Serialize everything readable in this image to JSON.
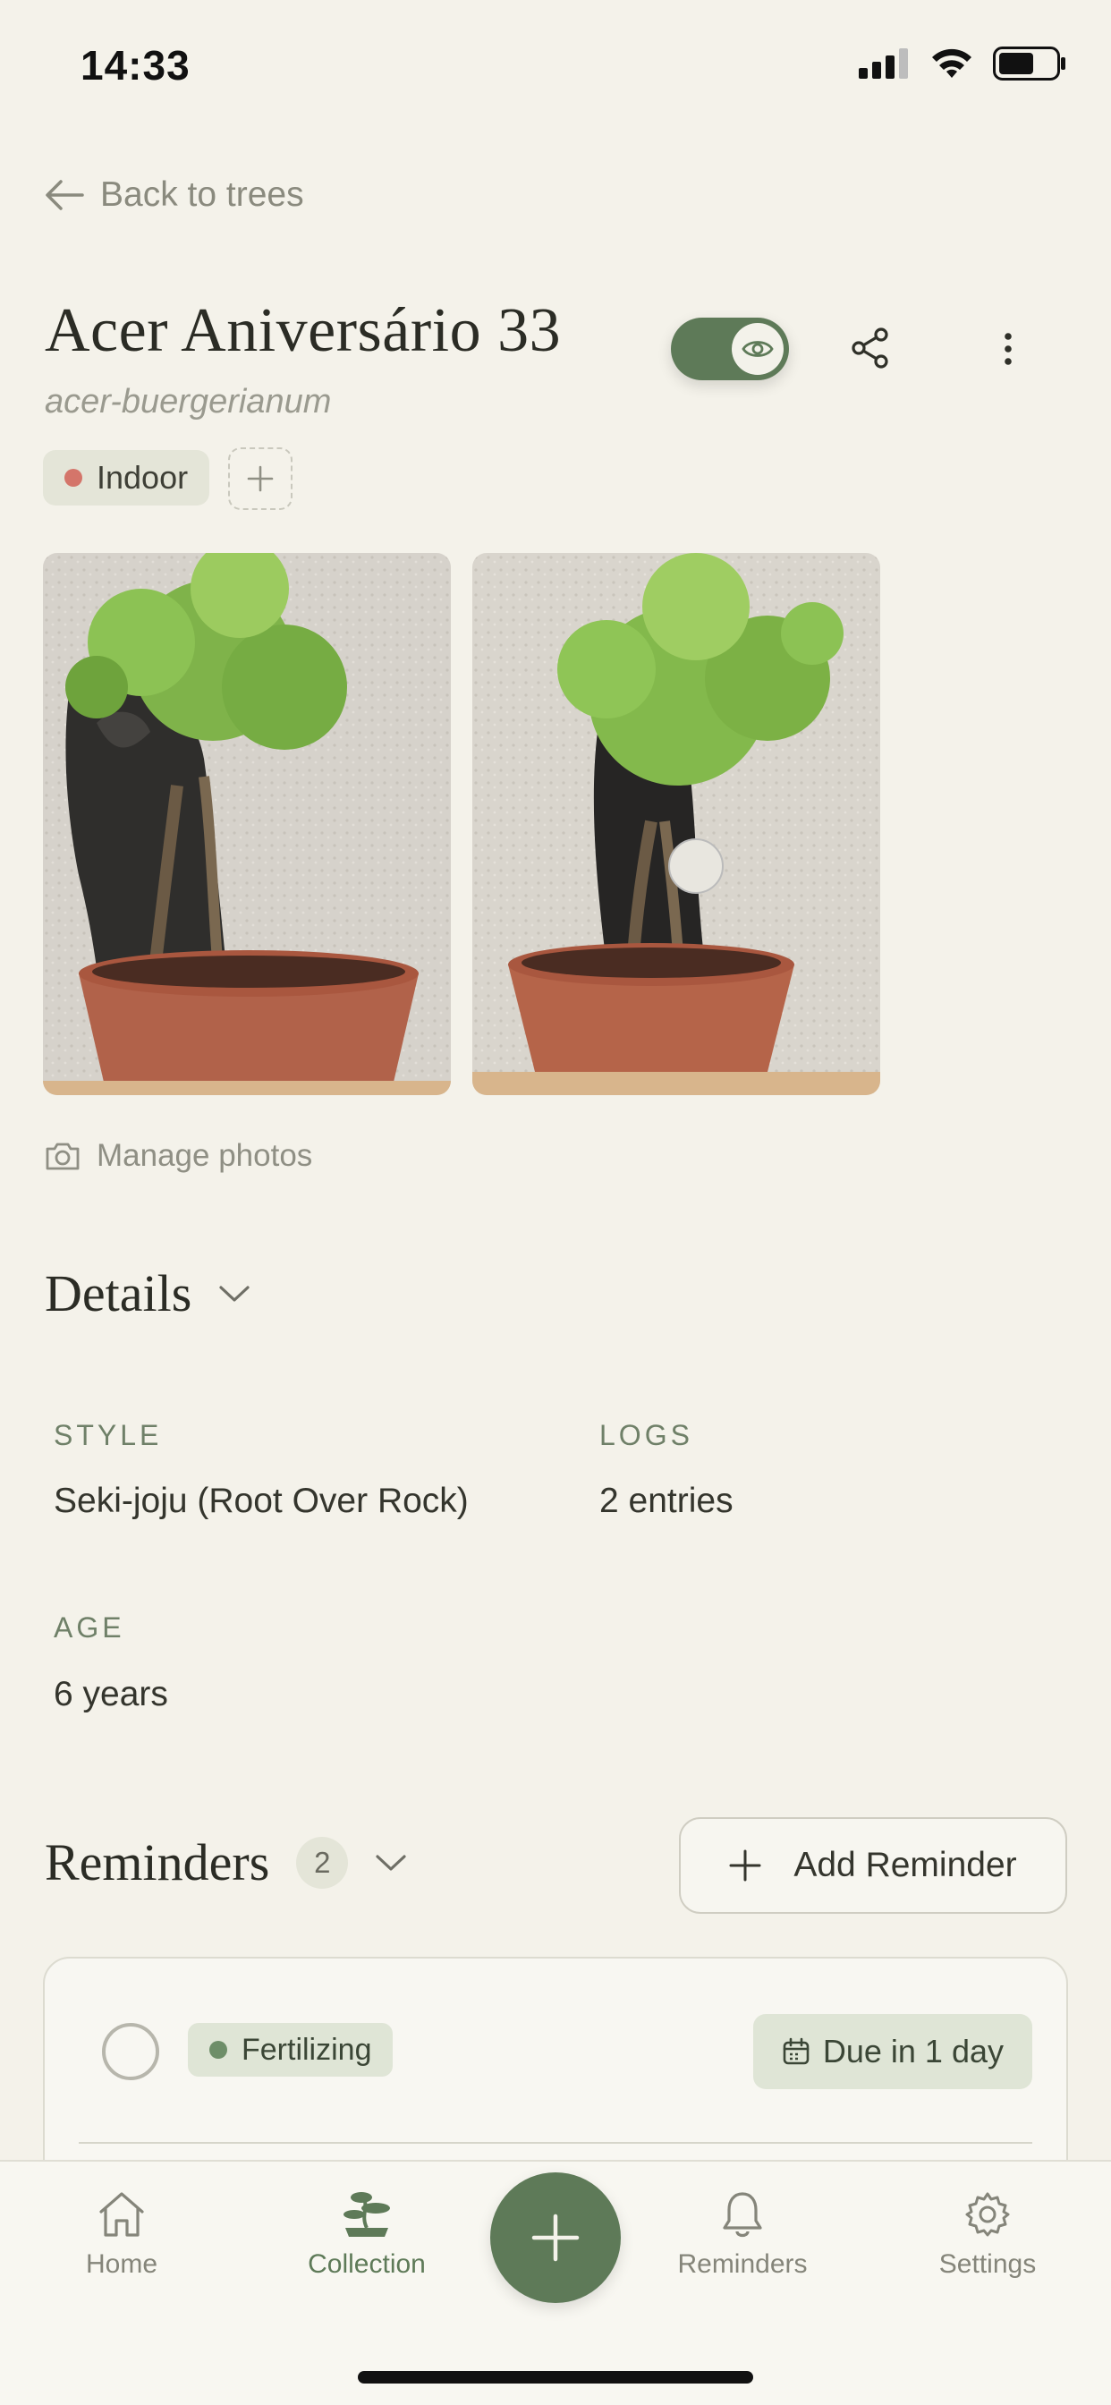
{
  "status_bar": {
    "time": "14:33"
  },
  "nav": {
    "back_label": "Back to trees"
  },
  "tree": {
    "name": "Acer Aniversário 33",
    "species": "acer-buergerianum"
  },
  "tags": [
    {
      "label": "Indoor",
      "dot_color": "#d4756a"
    }
  ],
  "photos": {
    "manage_label": "Manage photos"
  },
  "details": {
    "heading": "Details",
    "fields": [
      {
        "label": "STYLE",
        "value": "Seki-joju (Root Over Rock)"
      },
      {
        "label": "LOGS",
        "value": "2 entries"
      },
      {
        "label": "AGE",
        "value": "6 years"
      }
    ]
  },
  "reminders": {
    "heading": "Reminders",
    "count": "2",
    "add_label": "Add Reminder",
    "items": [
      {
        "tag": "Fertilizing",
        "tag_dot_color": "#6e8e69",
        "due": "Due in 1 day"
      }
    ]
  },
  "bottom_nav": {
    "items": [
      {
        "label": "Home"
      },
      {
        "label": "Collection"
      },
      {
        "label": "Reminders"
      },
      {
        "label": "Settings"
      }
    ]
  },
  "colors": {
    "accent": "#5e7a58",
    "background": "#f4f2ea",
    "badge_bg": "#dfe5d6"
  },
  "icons": {
    "back": "arrow-left-icon",
    "visibility": "eye-icon",
    "share": "share-icon",
    "more": "more-vertical-icon",
    "add_tag": "plus-icon",
    "camera": "camera-icon",
    "chevron": "chevron-down-icon",
    "calendar": "calendar-icon",
    "home": "home-icon",
    "collection": "bonsai-icon",
    "reminders": "bell-icon",
    "settings": "gear-icon",
    "fab": "plus-icon"
  }
}
